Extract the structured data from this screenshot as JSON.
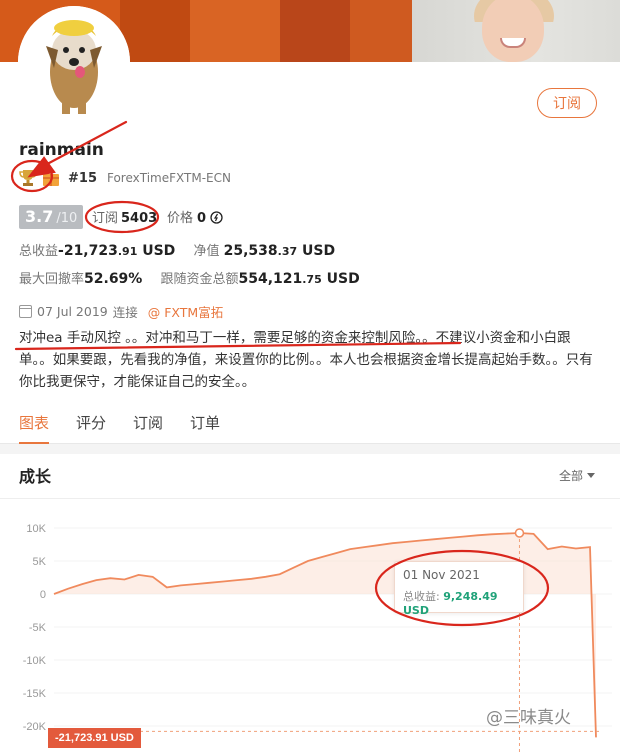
{
  "profile": {
    "follow_label": "订阅",
    "username": "rainmain",
    "rank": "#15",
    "broker": "ForexTimeFXTM-ECN",
    "score": "3.7",
    "score_max": "/10",
    "subscribers_label": "订阅",
    "subscribers_count": "5403",
    "price_label": "价格",
    "price_value": "0",
    "icons": [
      "trophy-icon",
      "gift-icon",
      "coin-icon",
      "calendar-icon"
    ]
  },
  "stats": {
    "total_profit_label": "总收益",
    "total_profit_main": "-21,723",
    "total_profit_dec": ".91",
    "total_profit_unit": " USD",
    "net_value_label": "净值",
    "net_value_main": "25,538",
    "net_value_dec": ".37",
    "net_value_unit": " USD",
    "max_drawdown_label": "最大回撤率",
    "max_drawdown_value": "52.69%",
    "follow_funds_label": "跟随资金总额",
    "follow_funds_main": "554,121",
    "follow_funds_dec": ".75",
    "follow_funds_unit": " USD"
  },
  "meta": {
    "date": "07 Jul 2019",
    "connect_label": "连接",
    "broker_link": "@ FXTM富拓"
  },
  "description": "对冲ea 手动风控 。。对冲和马丁一样，需要足够的资金来控制风险。。不建议小资金和小白跟单。。如果要跟，先看我的净值，来设置你的比例。。本人也会根据资金增长提高起始手数。。只有你比我更保守，才能保证自己的安全。。",
  "tabs": [
    {
      "label": "图表",
      "active": true
    },
    {
      "label": "评分",
      "active": false
    },
    {
      "label": "订阅",
      "active": false
    },
    {
      "label": "订单",
      "active": false
    }
  ],
  "growth": {
    "title": "成长",
    "range_label": "全部"
  },
  "tooltip": {
    "date": "01 Nov 2021",
    "label": "总收益:",
    "value": "9,248.49 USD"
  },
  "end_label": "-21,723.91 USD",
  "watermark": "@三味真火",
  "colors": {
    "accent": "#e8763d",
    "line": "#f08a5d",
    "area": "#fbe3d7",
    "tooltip_value": "#20a279",
    "end_label_bg": "#e35a3c",
    "annotation": "#d9261c"
  },
  "chart_data": {
    "type": "area",
    "y_ticks": [
      "10K",
      "5K",
      "0",
      "-5K",
      "-10K",
      "-15K",
      "-20K"
    ],
    "ylim": [
      -21724,
      10500
    ],
    "series": [
      {
        "values": [
          0,
          800,
          1500,
          2100,
          2400,
          2200,
          2900,
          2600,
          1000,
          1300,
          1500,
          1700,
          1900,
          2100,
          2300,
          2600,
          3000,
          4000,
          5000,
          5600,
          6200,
          6800,
          7100,
          7400,
          7700,
          7900,
          8100,
          8300,
          8500,
          8700,
          8900,
          9050,
          9150,
          9248,
          9100,
          6800,
          7200,
          6900,
          7100,
          -21724
        ]
      }
    ],
    "highlight": {
      "index": 33,
      "value": 9248.49,
      "label": "01 Nov 2021"
    }
  }
}
